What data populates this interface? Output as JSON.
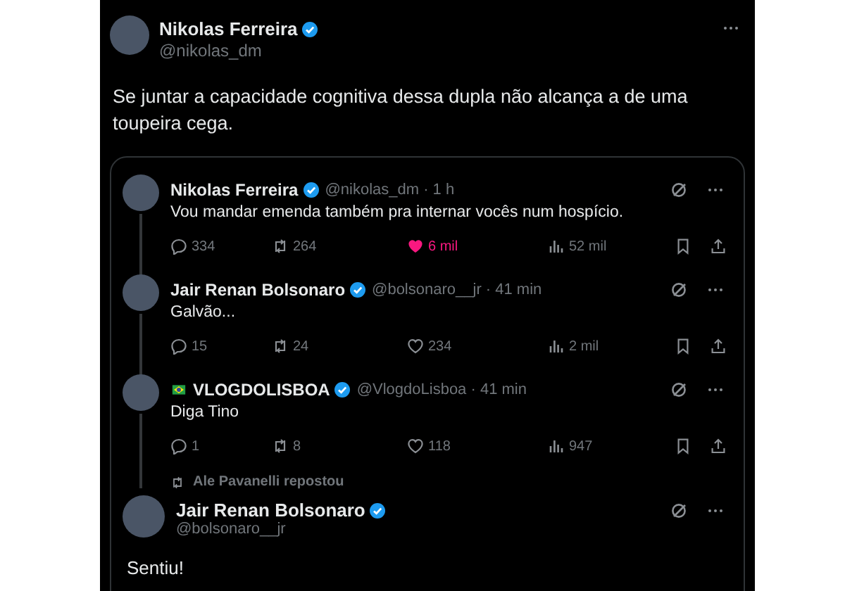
{
  "post": {
    "author": {
      "name": "Nikolas Ferreira",
      "handle": "@nikolas_dm",
      "verified": true
    },
    "text": "Se juntar a capacidade cognitiva dessa dupla não alcança a de uma toupeira cega."
  },
  "quote": {
    "thread": [
      {
        "kind": "reply",
        "name": "Nikolas Ferreira",
        "flag": false,
        "verified": true,
        "handle": "@nikolas_dm · 1 h",
        "text": "Vou mandar emenda também pra internar vocês num hospício.",
        "replies": "334",
        "reposts": "264",
        "likes": "6 mil",
        "liked": true,
        "views": "52 mil"
      },
      {
        "kind": "reply",
        "name": "Jair Renan Bolsonaro",
        "flag": false,
        "verified": true,
        "handle": "@bolsonaro__jr · 41 min",
        "text": "Galvão...",
        "replies": "15",
        "reposts": "24",
        "likes": "234",
        "liked": false,
        "views": "2 mil"
      },
      {
        "kind": "reply",
        "name": "VLOGDOLISBOA",
        "flag": true,
        "verified": true,
        "handle": "@VlogdoLisboa · 41 min",
        "text": "Diga Tino",
        "replies": "1",
        "reposts": "8",
        "likes": "118",
        "liked": false,
        "views": "947"
      },
      {
        "kind": "repost",
        "reposted_by": "Ale Pavanelli repostou",
        "name": "Jair Renan Bolsonaro",
        "flag": false,
        "verified": true,
        "handle": "@bolsonaro__jr",
        "text": "Sentiu!"
      }
    ]
  }
}
